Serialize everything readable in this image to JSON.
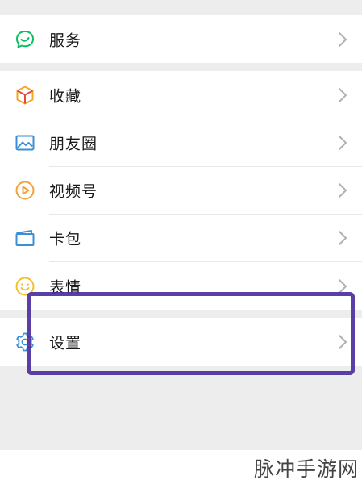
{
  "menu": {
    "service": {
      "label": "服务",
      "icon": "service-icon",
      "color": "#07c160"
    },
    "favorites": {
      "label": "收藏",
      "icon": "favorites-cube-icon",
      "color": "#f5a623"
    },
    "moments": {
      "label": "朋友圈",
      "icon": "moments-photo-icon",
      "color": "#3b8fd6"
    },
    "channels": {
      "label": "视频号",
      "icon": "channels-play-icon",
      "color": "#f0a23b"
    },
    "cards": {
      "label": "卡包",
      "icon": "card-wallet-icon",
      "color": "#3b8fd6"
    },
    "stickers": {
      "label": "表情",
      "icon": "smiley-icon",
      "color": "#f5c02a"
    },
    "settings": {
      "label": "设置",
      "icon": "gear-icon",
      "color": "#3b8fd6"
    }
  },
  "highlight_color": "#4b2f9e",
  "watermark": "脉冲手游网"
}
